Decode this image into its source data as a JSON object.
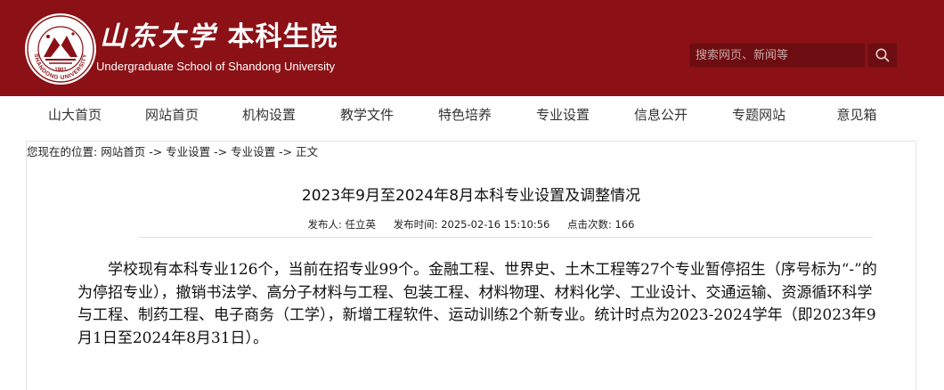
{
  "header": {
    "brand_cn_calligraphy": "山东大学",
    "brand_cn_suffix": "本科生院",
    "brand_en": "Undergraduate School of Shandong University",
    "emblem": {
      "text_upper": "SHANDONG UNIVERSITY",
      "year": "1901"
    },
    "search": {
      "placeholder": "搜索网页、新闻等"
    }
  },
  "nav": {
    "items": [
      {
        "label": "山大首页"
      },
      {
        "label": "网站首页"
      },
      {
        "label": "机构设置"
      },
      {
        "label": "教学文件"
      },
      {
        "label": "特色培养"
      },
      {
        "label": "专业设置"
      },
      {
        "label": "信息公开"
      },
      {
        "label": "专题网站"
      },
      {
        "label": "意见箱"
      }
    ]
  },
  "breadcrumb": {
    "prefix": "您现在的位置:",
    "items": [
      "网站首页",
      "专业设置",
      "专业设置",
      "正文"
    ],
    "separator": "->"
  },
  "article": {
    "title": "2023年9月至2024年8月本科专业设置及调整情况",
    "meta": {
      "author": "发布人: 任立英",
      "date": "发布时间: 2025-02-16 15:10:56",
      "views": "点击次数: 166"
    },
    "body": "学校现有本科专业126个，当前在招专业99个。金融工程、世界史、土木工程等27个专业暂停招生（序号标为“-”的为停招专业），撤销书法学、高分子材料与工程、包装工程、材料物理、材料化学、工业设计、交通运输、资源循环科学与工程、制药工程、电子商务（工学），新增工程软件、运动训练2个新专业。统计时点为2023-2024学年（即2023年9月1日至2024年8月31日）。"
  },
  "colors": {
    "brand": "#8b1116",
    "search_bg": "#6d0d11"
  }
}
